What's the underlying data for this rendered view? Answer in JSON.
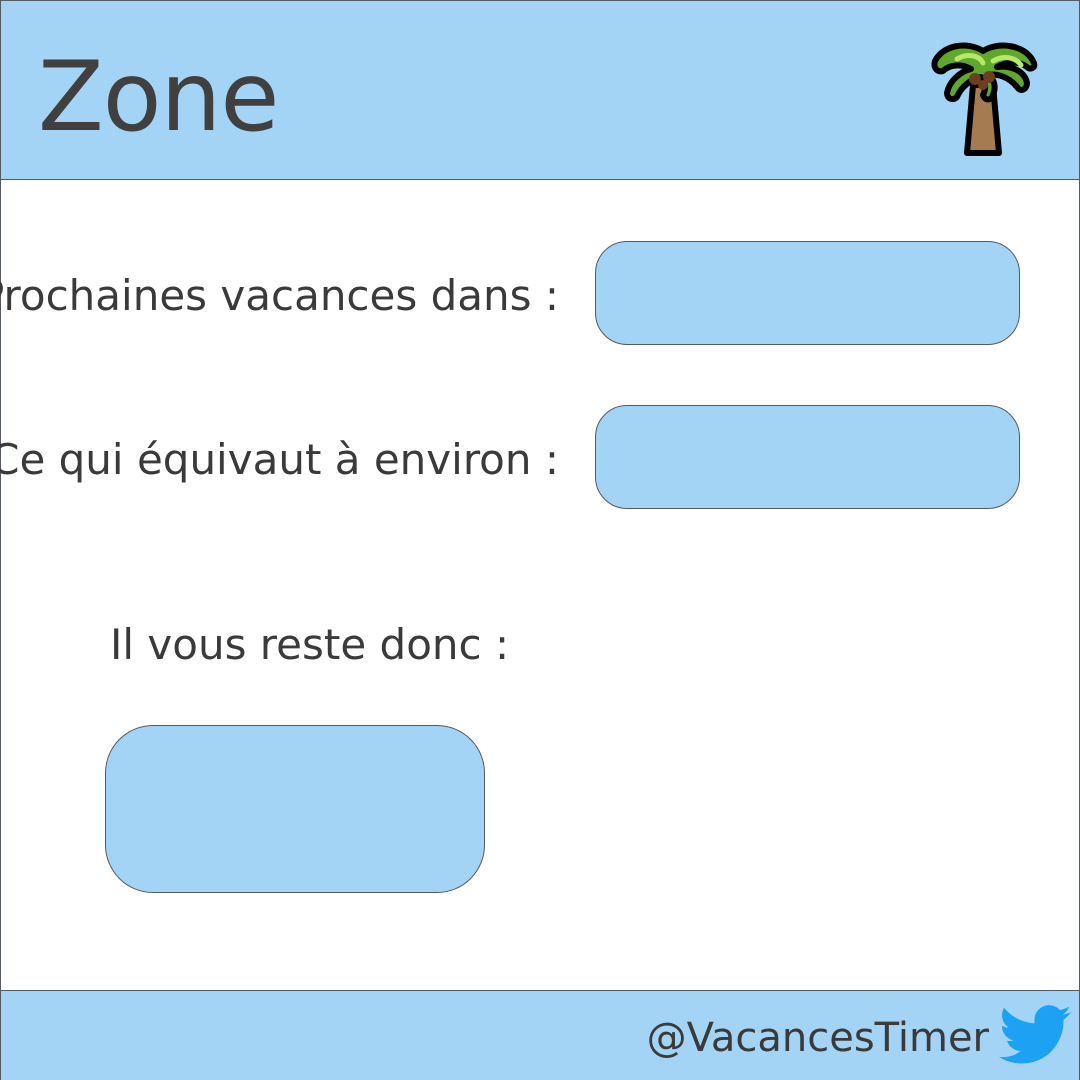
{
  "header": {
    "title": "Zone",
    "icon": "palm-tree-icon"
  },
  "main": {
    "next_label": "Prochaines vacances dans :",
    "next_value": "",
    "approx_label": "Ce qui équivaut à environ :",
    "approx_value": "",
    "remaining_label": "Il vous reste donc :",
    "remaining_value": ""
  },
  "footer": {
    "handle": "@VacancesTimer",
    "icon": "twitter-bird-icon"
  },
  "colors": {
    "panel_blue": "#a4d4f5",
    "border": "#555a60",
    "text": "#3d3d3d",
    "twitter_blue": "#1da1f2"
  }
}
